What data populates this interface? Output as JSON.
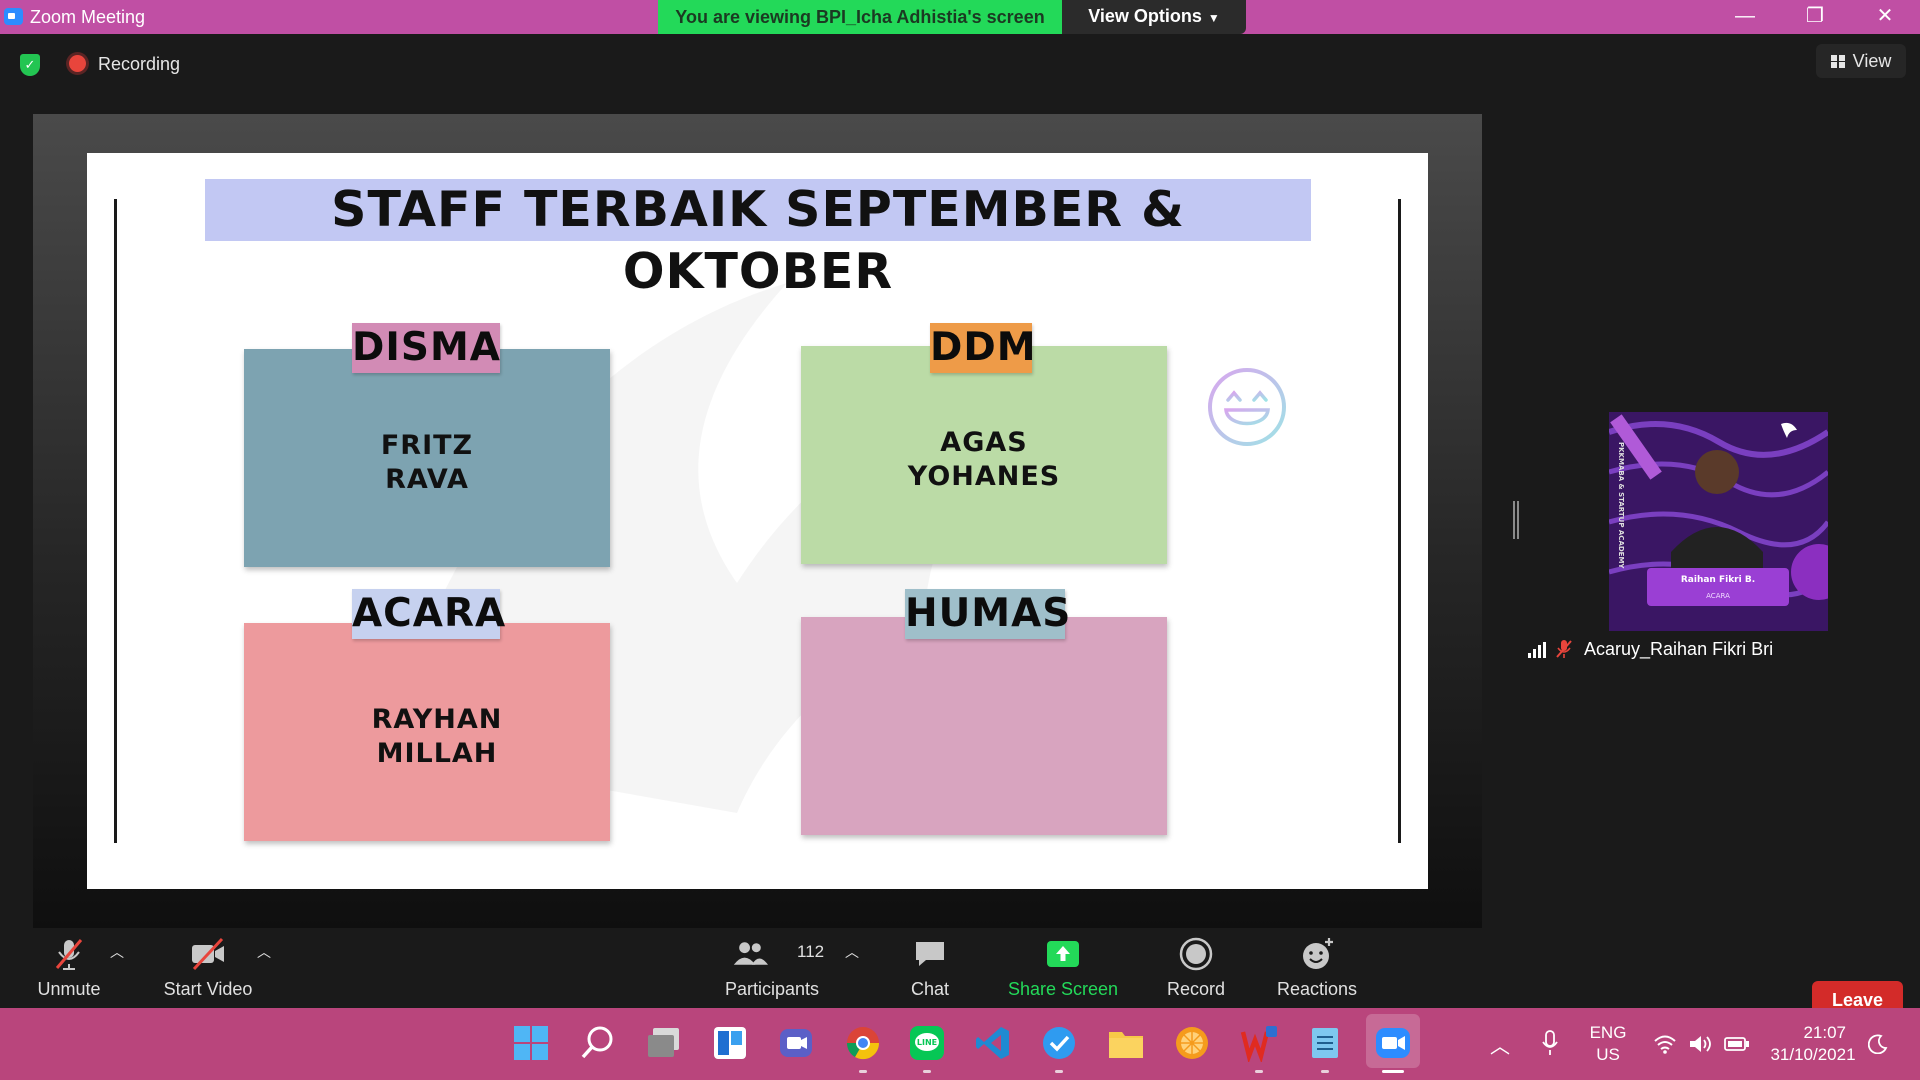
{
  "window": {
    "app_title": "Zoom Meeting",
    "viewing_banner": "You are viewing BPI_Icha Adhistia's screen",
    "view_options": "View Options",
    "minimize": "—",
    "restore": "❐",
    "close": "✕"
  },
  "meeting": {
    "recording_label": "Recording",
    "view_label": "View"
  },
  "slide": {
    "title": "STAFF TERBAIK SEPTEMBER & OKTOBER",
    "cards": [
      {
        "tag": "DISMA",
        "names": [
          "FRITZ",
          "RAVA"
        ],
        "card_color": "#7da3b1",
        "tag_color": "#d28bb5"
      },
      {
        "tag": "DDM",
        "names": [
          "AGAS",
          "YOHANES"
        ],
        "card_color": "#bbdba6",
        "tag_color": "#ee9b48"
      },
      {
        "tag": "ACARA",
        "names": [
          "RAYHAN",
          "MILLAH"
        ],
        "card_color": "#ed9a9d",
        "tag_color": "#c6d1ef"
      },
      {
        "tag": "HUMAS",
        "names": [],
        "card_color": "#d8a4bf",
        "tag_color": "#9fbfca"
      }
    ]
  },
  "participant": {
    "name": "Acaruy_Raihan Fikri Bri",
    "photo_name": "Raihan Fikri B.",
    "photo_role": "ACARA",
    "photo_side_text": "PKKMABA & STARTUP ACADEMY"
  },
  "toolbar": {
    "unmute": "Unmute",
    "start_video": "Start Video",
    "participants": "Participants",
    "participants_count": "112",
    "chat": "Chat",
    "share_screen": "Share Screen",
    "record": "Record",
    "reactions": "Reactions",
    "leave": "Leave"
  },
  "taskbar": {
    "lang_top": "ENG",
    "lang_bottom": "US",
    "time": "21:07",
    "date": "31/10/2021"
  },
  "colors": {
    "title_bar": "#c04fa4",
    "banner_green": "#23d959",
    "leave_red": "#d32b29",
    "taskbar": "#b9457c",
    "slide_title_bg": "#c2c8f3"
  }
}
